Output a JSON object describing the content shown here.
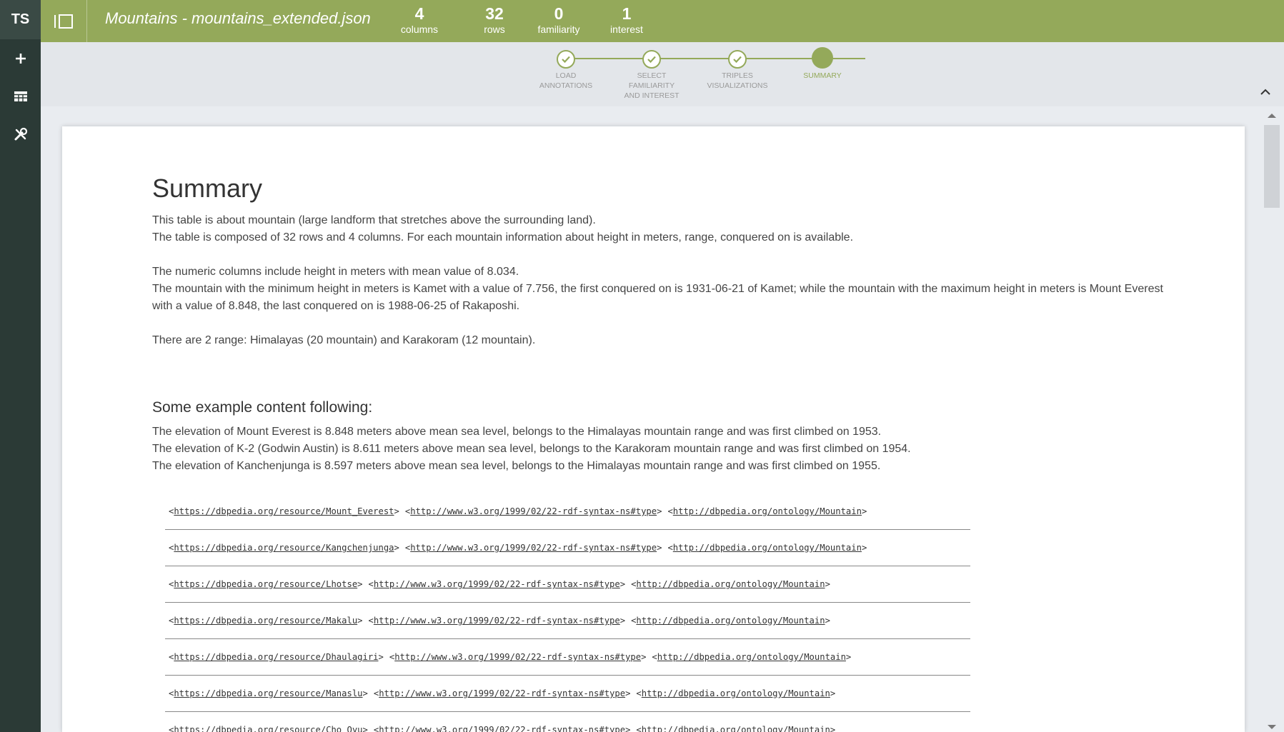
{
  "app": {
    "logo": "TS"
  },
  "rail": {
    "items": [
      {
        "icon": "plus-icon"
      },
      {
        "icon": "table-icon"
      },
      {
        "icon": "tools-icon"
      }
    ]
  },
  "header": {
    "title": "Mountains - mountains_extended.json",
    "stats": [
      {
        "value": "4",
        "label": "columns"
      },
      {
        "value": "32",
        "label": "rows"
      },
      {
        "value": "0",
        "label": "familiarity"
      },
      {
        "value": "1",
        "label": "interest"
      }
    ]
  },
  "stepper": {
    "steps": [
      {
        "label": "LOAD\nANNOTATIONS",
        "done": true
      },
      {
        "label": "SELECT\nFAMILIARITY\nAND INTEREST",
        "done": true
      },
      {
        "label": "TRIPLES\nVISUALIZATIONS",
        "done": true
      },
      {
        "label": "SUMMARY",
        "active": true
      }
    ]
  },
  "summary": {
    "heading": "Summary",
    "para1_l1": "This table is about mountain (large landform that stretches above the surrounding land).",
    "para1_l2": "The table is composed of 32 rows and 4 columns. For each mountain information about height in meters, range, conquered on is available.",
    "para2_l1": "The numeric columns include height in meters with mean value of 8.034.",
    "para2_l2": "The mountain with the minimum height in meters is Kamet with a value of 7.756, the first conquered on is 1931-06-21 of Kamet; while the mountain with the maximum height in meters is Mount Everest with a value of 8.848, the last conquered on is 1988-06-25 of Rakaposhi.",
    "para3": "There are 2 range: Himalayas (20 mountain) and Karakoram (12 mountain).",
    "examples_heading": "Some example content following:",
    "ex1": "The elevation of Mount Everest is 8.848 meters above mean sea level, belongs to the Himalayas mountain range and was first climbed on 1953.",
    "ex2": "The elevation of K-2 (Godwin Austin) is 8.611 meters above mean sea level, belongs to the Karakoram mountain range and was first climbed on 1954.",
    "ex3": "The elevation of Kanchenjunga is 8.597 meters above mean sea level, belongs to the Himalayas mountain range and was first climbed on 1955."
  },
  "triples": [
    {
      "s": "https://dbpedia.org/resource/Mount_Everest",
      "p": "http://www.w3.org/1999/02/22-rdf-syntax-ns#type",
      "o": "http://dbpedia.org/ontology/Mountain"
    },
    {
      "s": "https://dbpedia.org/resource/Kangchenjunga",
      "p": "http://www.w3.org/1999/02/22-rdf-syntax-ns#type",
      "o": "http://dbpedia.org/ontology/Mountain"
    },
    {
      "s": "https://dbpedia.org/resource/Lhotse",
      "p": "http://www.w3.org/1999/02/22-rdf-syntax-ns#type",
      "o": "http://dbpedia.org/ontology/Mountain"
    },
    {
      "s": "https://dbpedia.org/resource/Makalu",
      "p": "http://www.w3.org/1999/02/22-rdf-syntax-ns#type",
      "o": "http://dbpedia.org/ontology/Mountain"
    },
    {
      "s": "https://dbpedia.org/resource/Dhaulagiri",
      "p": "http://www.w3.org/1999/02/22-rdf-syntax-ns#type",
      "o": "http://dbpedia.org/ontology/Mountain"
    },
    {
      "s": "https://dbpedia.org/resource/Manaslu",
      "p": "http://www.w3.org/1999/02/22-rdf-syntax-ns#type",
      "o": "http://dbpedia.org/ontology/Mountain"
    },
    {
      "s": "https://dbpedia.org/resource/Cho_Oyu",
      "p": "http://www.w3.org/1999/02/22-rdf-syntax-ns#type",
      "o": "http://dbpedia.org/ontology/Mountain"
    }
  ],
  "colors": {
    "accent": "#94a95a",
    "rail": "#2b3a36",
    "background": "#e9ecf0"
  }
}
